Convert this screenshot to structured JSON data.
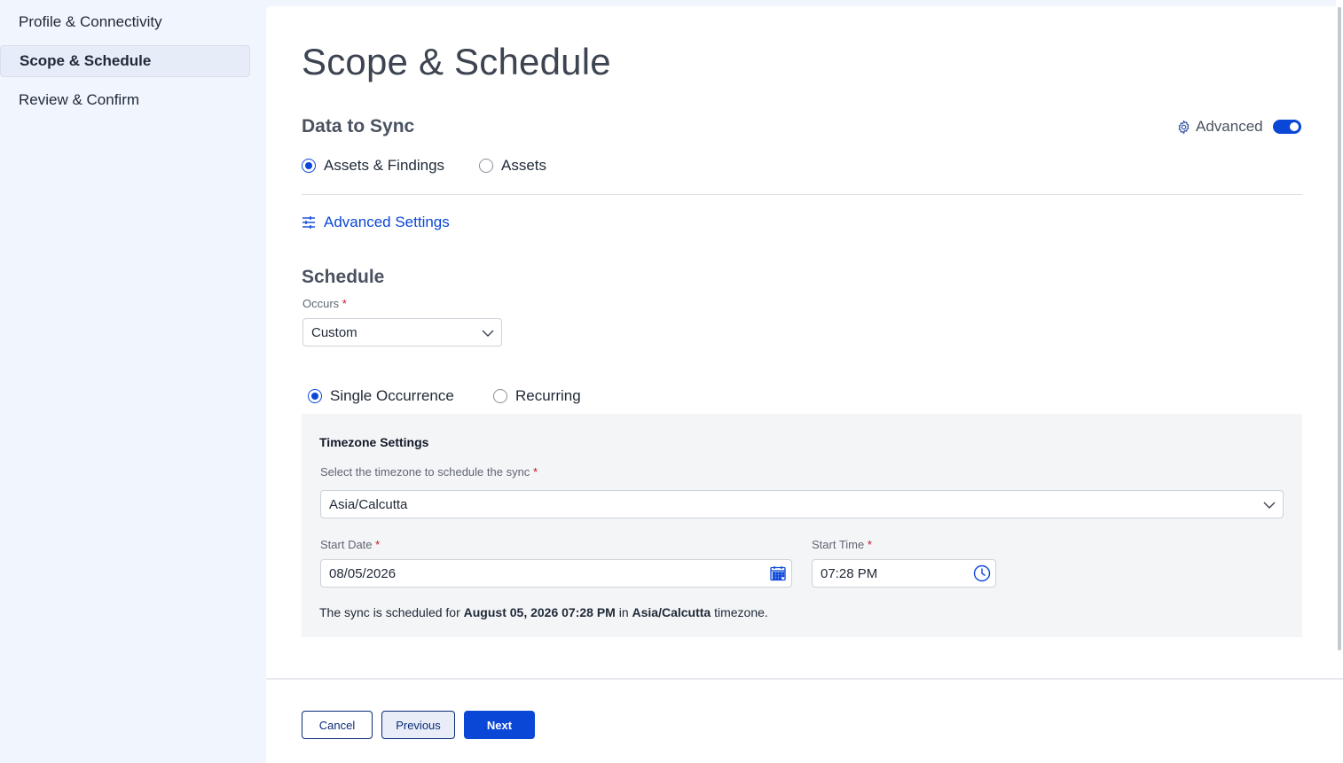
{
  "sidebar": {
    "items": [
      {
        "label": "Profile & Connectivity"
      },
      {
        "label": "Scope & Schedule"
      },
      {
        "label": "Review & Confirm"
      }
    ]
  },
  "page": {
    "title": "Scope & Schedule"
  },
  "data_to_sync": {
    "title": "Data to Sync",
    "advanced_label": "Advanced",
    "advanced_enabled": true,
    "options": [
      {
        "label": "Assets & Findings",
        "selected": true
      },
      {
        "label": "Assets",
        "selected": false
      }
    ],
    "advanced_settings_label": "Advanced Settings"
  },
  "schedule": {
    "title": "Schedule",
    "occurs_label": "Occurs",
    "occurs_value": "Custom",
    "required_mark": "*",
    "modes": [
      {
        "label": "Single Occurrence",
        "selected": true
      },
      {
        "label": "Recurring",
        "selected": false
      }
    ]
  },
  "timezone": {
    "title": "Timezone Settings",
    "select_label": "Select the timezone to schedule the sync",
    "value": "Asia/Calcutta",
    "start_date_label": "Start Date",
    "start_date": "08/05/2026",
    "start_time_label": "Start Time",
    "start_time": "07:28 PM",
    "summary_prefix": "The sync is scheduled for",
    "summary_datetime": "August 05, 2026 07:28 PM",
    "summary_in": "in",
    "summary_tz": "Asia/Calcutta",
    "summary_suffix": "timezone."
  },
  "footer": {
    "cancel_label": "Cancel",
    "previous_label": "Previous",
    "next_label": "Next"
  },
  "colors": {
    "accent": "#0b47d6",
    "sidebar_bg": "#f1f5fd",
    "required": "#c8102e"
  },
  "icons": [
    "gear-icon",
    "sliders-icon",
    "chevron-down-icon",
    "calendar-icon",
    "clock-icon"
  ]
}
